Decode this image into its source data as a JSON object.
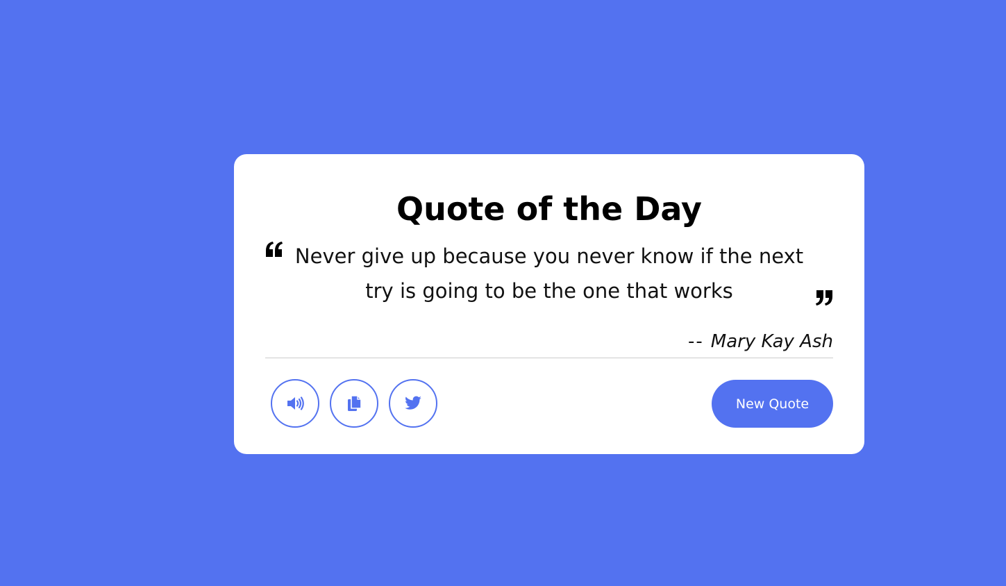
{
  "card": {
    "title": "Quote of the Day",
    "quote_text": "Never give up because you never know if the next try is going to be the one that works",
    "author_prefix": "--",
    "author_name": "Mary Kay Ash"
  },
  "actions": {
    "speak_icon": "volume-up-icon",
    "copy_icon": "copy-icon",
    "twitter_icon": "twitter-icon",
    "new_quote_label": "New Quote"
  },
  "colors": {
    "background": "#5372f0",
    "accent": "#5372f0",
    "card": "#ffffff"
  }
}
